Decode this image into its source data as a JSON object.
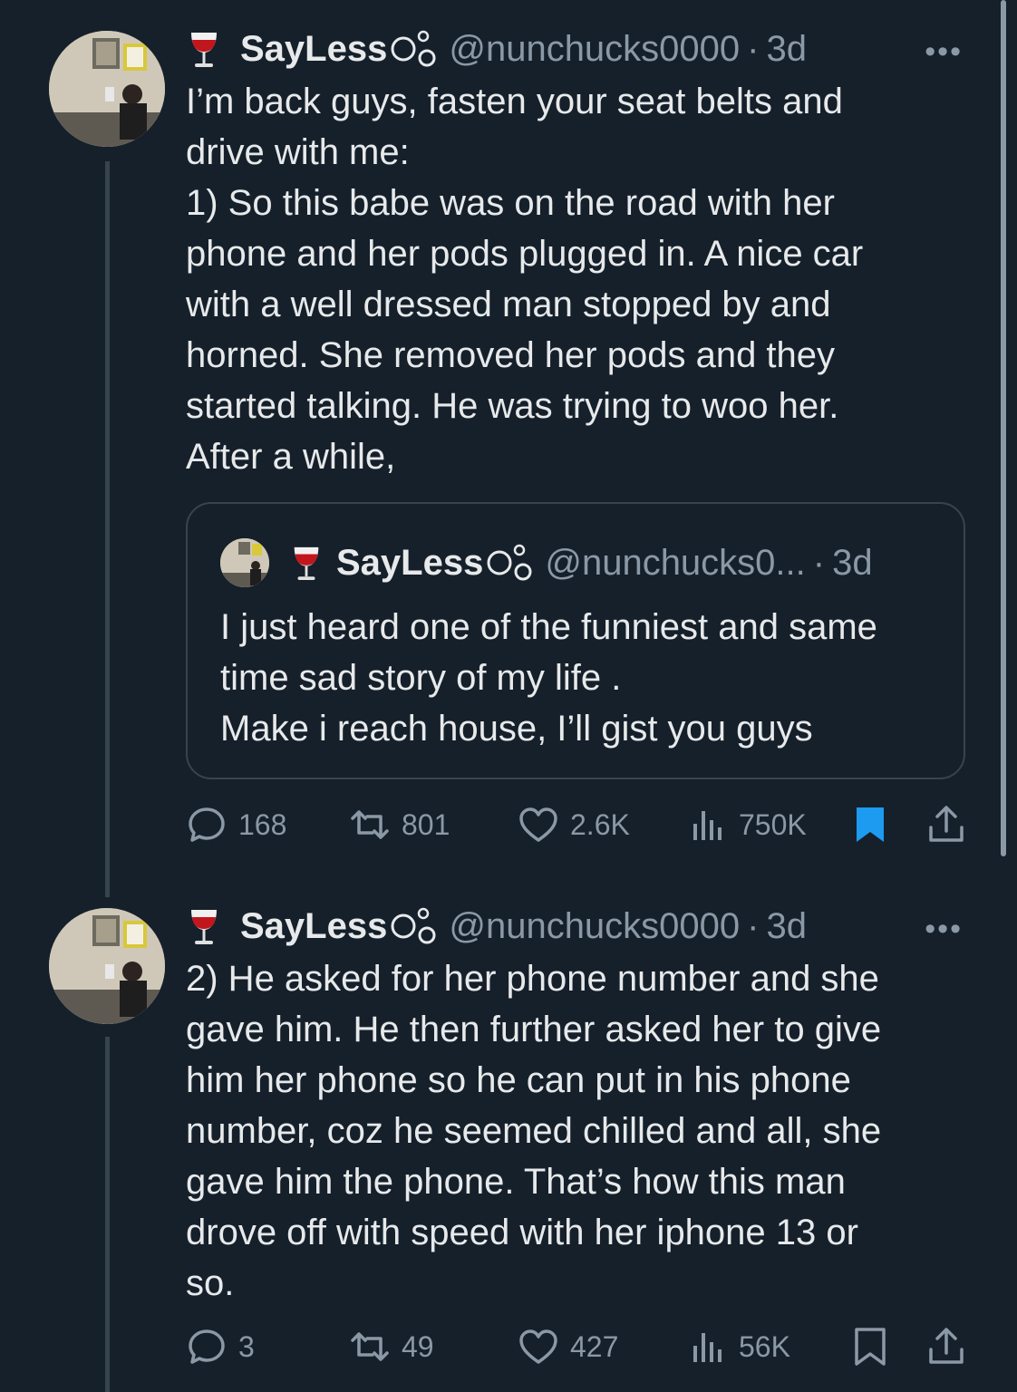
{
  "tweets": [
    {
      "display_name": "SayLess",
      "handle": "@nunchucks0000",
      "time": "3d",
      "text": "I’m back guys, fasten your seat belts and\ndrive with me:\n1) So this babe was on the road with her\nphone and her pods plugged in. A nice car\nwith a well dressed man stopped by and\nhorned. She removed her pods and they\nstarted talking. He was trying to woo her.\nAfter a while,",
      "quote": {
        "display_name": "SayLess",
        "handle": "@nunchucks0...",
        "time": "3d",
        "text": "I just heard one of the funniest and same\ntime sad story of my life .\nMake i reach house, I’ll gist you guys"
      },
      "replies": "168",
      "retweets": "801",
      "likes": "2.6K",
      "views": "750K",
      "bookmarked": true
    },
    {
      "display_name": "SayLess",
      "handle": "@nunchucks0000",
      "time": "3d",
      "text": "2) He asked for her phone number and she\ngave him. He then further asked her to give\nhim her phone so he can put in his phone\nnumber, coz he seemed chilled and all, she\ngave him the phone. That’s how this man\ndrove off with speed with her iphone 13 or\nso.",
      "replies": "3",
      "retweets": "49",
      "likes": "427",
      "views": "56K",
      "bookmarked": false
    }
  ],
  "ui": {
    "dot": "·",
    "more": "•••",
    "accent_color": "#1d9bf0",
    "icons": {
      "emoji": "wine-glass-icon",
      "badge": "bubbles-icon",
      "reply": "reply-icon",
      "retweet": "retweet-icon",
      "like": "heart-icon",
      "views": "views-icon",
      "bookmark": "bookmark-icon",
      "share": "share-icon"
    }
  }
}
